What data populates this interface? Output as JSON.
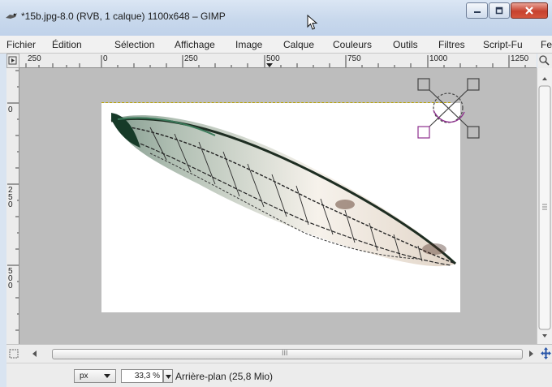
{
  "window": {
    "title": "*15b.jpg-8.0 (RVB, 1 calque) 1100x648 – GIMP",
    "app_icon": "gimp-wilber-icon",
    "buttons": {
      "minimize": "minimize-icon",
      "maximize": "maximize-icon",
      "close": "close-icon"
    }
  },
  "menu": {
    "items": [
      "Fichier",
      "Édition",
      "Sélection",
      "Affichage",
      "Image",
      "Calque",
      "Couleurs",
      "Outils",
      "Filtres",
      "Script-Fu",
      "Fe"
    ]
  },
  "rulers": {
    "horizontal_labels": [
      "250",
      "0",
      "250",
      "500",
      "750",
      "1000",
      "1250"
    ],
    "vertical_labels": [
      "0",
      "250",
      "500"
    ]
  },
  "canvas": {
    "image_subject": "cicada-wing",
    "background": "#bdbdbd",
    "image_background": "#ffffff",
    "transform_handles": "rotate-transform-handles-icon"
  },
  "scrollbars": {
    "horizontal_thumb_label": "III"
  },
  "statusbar": {
    "unit": "px",
    "zoom": "33,3 %",
    "layer_info": "Arrière-plan (25,8 Mio)"
  }
}
